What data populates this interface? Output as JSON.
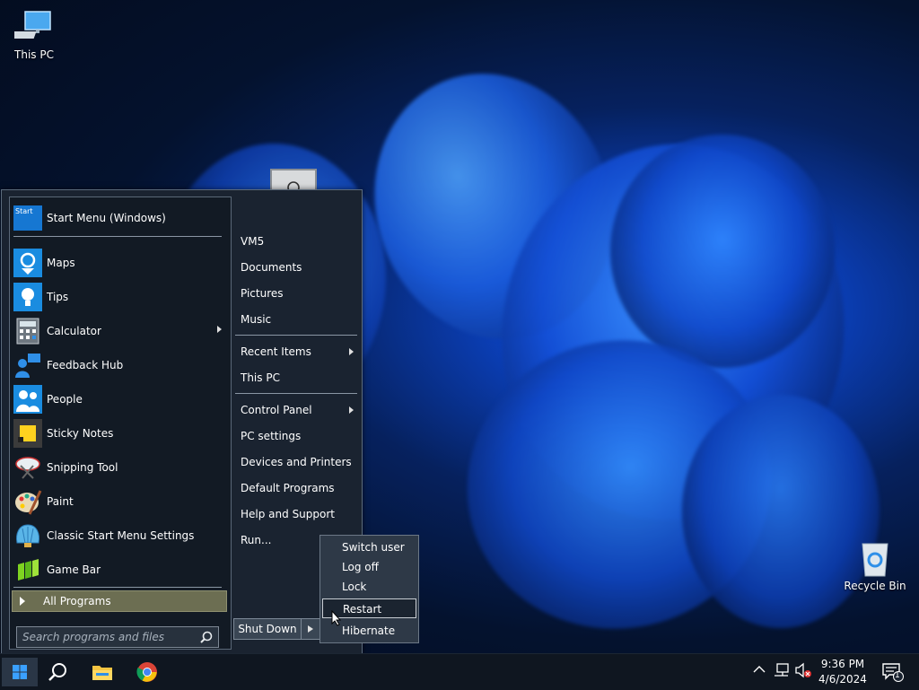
{
  "desktop": {
    "icons": [
      {
        "label": "This PC",
        "icon": "computer-icon"
      },
      {
        "label": "Recycle Bin",
        "icon": "recycle-bin-icon"
      }
    ]
  },
  "start_menu": {
    "header": {
      "label": "Start Menu (Windows)",
      "icon_text": "Start"
    },
    "apps": [
      {
        "label": "Maps",
        "icon": "maps-icon",
        "has_submenu": false
      },
      {
        "label": "Tips",
        "icon": "tips-icon",
        "has_submenu": false
      },
      {
        "label": "Calculator",
        "icon": "calculator-icon",
        "has_submenu": true
      },
      {
        "label": "Feedback Hub",
        "icon": "feedback-hub-icon",
        "has_submenu": false
      },
      {
        "label": "People",
        "icon": "people-icon",
        "has_submenu": false
      },
      {
        "label": "Sticky Notes",
        "icon": "sticky-notes-icon",
        "has_submenu": false
      },
      {
        "label": "Snipping Tool",
        "icon": "snipping-tool-icon",
        "has_submenu": false
      },
      {
        "label": "Paint",
        "icon": "paint-icon",
        "has_submenu": false
      },
      {
        "label": "Classic Start Menu Settings",
        "icon": "shell-icon",
        "has_submenu": false
      },
      {
        "label": "Game Bar",
        "icon": "game-bar-icon",
        "has_submenu": false
      }
    ],
    "all_programs": "All Programs",
    "search_placeholder": "Search programs and files",
    "right_items": [
      {
        "label": "VM5"
      },
      {
        "label": "Documents"
      },
      {
        "label": "Pictures"
      },
      {
        "label": "Music"
      },
      {
        "label": "Recent Items"
      },
      {
        "label": "This PC"
      },
      {
        "label": "Control Panel"
      },
      {
        "label": "PC settings"
      },
      {
        "label": "Devices and Printers"
      },
      {
        "label": "Default Programs"
      },
      {
        "label": "Help and Support"
      },
      {
        "label": "Run..."
      }
    ],
    "shutdown_label": "Shut Down",
    "shutdown_submenu": [
      {
        "label": "Switch user"
      },
      {
        "label": "Log off"
      },
      {
        "label": "Lock"
      },
      {
        "label": "Restart"
      },
      {
        "label": "Hibernate"
      }
    ]
  },
  "taskbar": {
    "clock_time": "9:36 PM",
    "clock_date": "4/6/2024",
    "notification_count": "1"
  },
  "colors": {
    "accent": "#1677d2",
    "highlight": "#6c6e52"
  }
}
